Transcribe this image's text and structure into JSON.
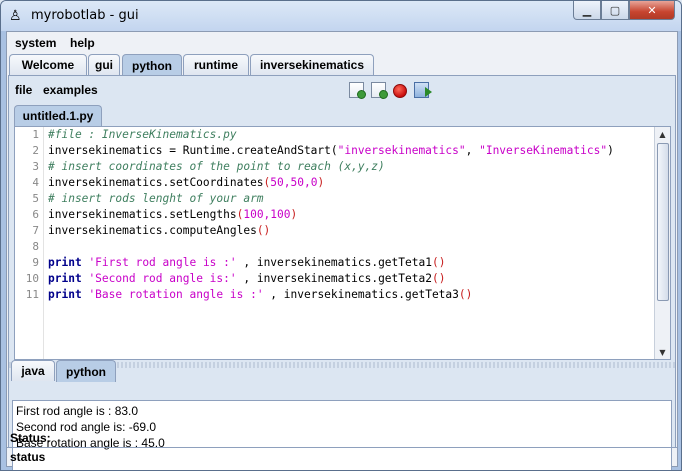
{
  "window": {
    "title": "myrobotlab - gui",
    "icon": "robot-icon"
  },
  "menu": [
    "system",
    "help"
  ],
  "top_tabs": [
    "Welcome",
    "gui",
    "python",
    "runtime",
    "inversekinematics"
  ],
  "active_top_tab": "python",
  "python_menu": {
    "file": "file",
    "examples": "examples"
  },
  "toolbar_icons": [
    "new-file-icon",
    "open-file-icon",
    "stop-icon",
    "run-script-icon"
  ],
  "file_tab": "untitled.1.py",
  "line_numbers": [
    "1",
    "2",
    "3",
    "4",
    "5",
    "6",
    "7",
    "8",
    "9",
    "10",
    "11"
  ],
  "code": [
    "#file : InverseKinematics.py",
    "inversekinematics = Runtime.createAndStart(\"inversekinematics\", \"InverseKinematics\")",
    "# insert coordinates of the point to reach (x,y,z)",
    "inversekinematics.setCoordinates(50,50,0)",
    "# insert rods lenght of your arm",
    "inversekinematics.setLengths(100,100)",
    "inversekinematics.computeAngles()",
    "",
    "print 'First rod angle is :' , inversekinematics.getTeta1()",
    "print 'Second rod angle is:' , inversekinematics.getTeta2()",
    "print 'Base rotation angle is :' , inversekinematics.getTeta3()"
  ],
  "bottom_tabs": [
    "java",
    "python"
  ],
  "active_bottom_tab": "python",
  "output_lines": [
    "First rod angle is : 83.0",
    "Second rod angle is: -69.0",
    "Base rotation angle is : 45.0"
  ],
  "status_label": "Status:",
  "statusbar_text": "status"
}
